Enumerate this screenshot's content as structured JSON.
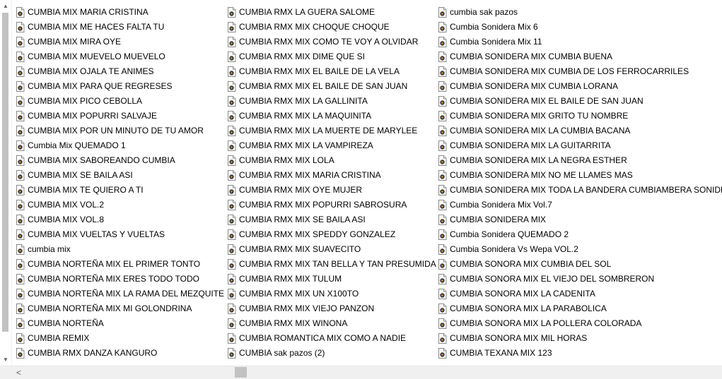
{
  "file_icon": "media-file-icon",
  "scrollbar": {
    "left_arrow": "<",
    "up_arrow": "▲",
    "down_arrow": "▼"
  },
  "columns": [
    [
      "CUMBIA MIX MARIA CRISTINA",
      "CUMBIA MIX ME HACES FALTA TU",
      "CUMBIA MIX MIRA OYE",
      "CUMBIA MIX MUEVELO MUEVELO",
      "CUMBIA MIX OJALA TE ANIMES",
      "CUMBIA MIX PARA QUE REGRESES",
      "CUMBIA MIX PICO CEBOLLA",
      "CUMBIA MIX POPURRI SALVAJE",
      "CUMBIA MIX POR UN MINUTO DE TU AMOR",
      "Cumbia Mix QUEMADO 1",
      "CUMBIA MIX SABOREANDO CUMBIA",
      "CUMBIA MIX SE BAILA ASI",
      "CUMBIA MIX TE QUIERO A TI",
      "CUMBIA MIX VOL.2",
      "CUMBIA MIX VOL.8",
      "CUMBIA MIX VUELTAS Y VUELTAS",
      "cumbia mix",
      "CUMBIA NORTEÑA MIX EL PRIMER TONTO",
      "CUMBIA NORTEÑA MIX ERES TODO TODO",
      "CUMBIA NORTEÑA MIX LA RAMA DEL MEZQUITE",
      "CUMBIA NORTEÑA MIX MI GOLONDRINA",
      "CUMBIA NORTEÑA",
      "CUMBIA REMIX",
      "CUMBIA RMX DANZA KANGURO"
    ],
    [
      "CUMBIA RMX LA GUERA SALOME",
      "CUMBIA RMX MIX CHOQUE CHOQUE",
      "CUMBIA RMX MIX COMO TE VOY A OLVIDAR",
      "CUMBIA RMX MIX DIME QUE SI",
      "CUMBIA RMX MIX EL BAILE DE LA VELA",
      "CUMBIA RMX MIX EL BAILE DE SAN JUAN",
      "CUMBIA RMX MIX LA GALLINITA",
      "CUMBIA RMX MIX LA MAQUINITA",
      "CUMBIA RMX MIX LA MUERTE DE MARYLEE",
      "CUMBIA RMX MIX LA VAMPIREZA",
      "CUMBIA RMX MIX LOLA",
      "CUMBIA RMX MIX MARIA CRISTINA",
      "CUMBIA RMX MIX OYE MUJER",
      "CUMBIA RMX MIX POPURRI SABROSURA",
      "CUMBIA RMX MIX SE BAILA ASI",
      "CUMBIA RMX MIX SPEDDY GONZALEZ",
      "CUMBIA RMX MIX SUAVECITO",
      "CUMBIA RMX MIX TAN BELLA Y TAN PRESUMIDA",
      "CUMBIA RMX MIX TULUM",
      "CUMBIA RMX MIX UN X100TO",
      "CUMBIA RMX MIX VIEJO PANZON",
      "CUMBIA RMX MIX WINONA",
      "CUMBIA ROMANTICA MIX COMO A NADIE",
      "CUMBIA sak pazos (2)"
    ],
    [
      "cumbia sak pazos",
      "Cumbia Sonidera Mix 6",
      "Cumbia Sonidera Mix 11",
      "CUMBIA SONIDERA MIX CUMBIA BUENA",
      "CUMBIA SONIDERA MIX CUMBIA DE LOS FERROCARRILES",
      "CUMBIA SONIDERA MIX CUMBIA LORANA",
      "CUMBIA SONIDERA MIX EL BAILE DE SAN JUAN",
      "CUMBIA SONIDERA MIX GRITO TU NOMBRE",
      "CUMBIA SONIDERA MIX LA CUMBIA BACANA",
      "CUMBIA SONIDERA MIX LA GUITARRITA",
      "CUMBIA SONIDERA MIX LA NEGRA ESTHER",
      "CUMBIA SONIDERA MIX NO ME LLAMES MAS",
      "CUMBIA SONIDERA MIX TODA LA BANDERA CUMBIAMBERA SONIDERA",
      "Cumbia Sonidera Mix Vol.7",
      "CUMBIA SONIDERA MIX",
      "Cumbia Sonidera QUEMADO 2",
      "Cumbia Sonidera Vs Wepa VOL.2",
      "CUMBIA SONORA MIX CUMBIA DEL SOL",
      "CUMBIA SONORA MIX EL VIEJO DEL SOMBRERON",
      "CUMBIA SONORA MIX LA CADENITA",
      "CUMBIA SONORA MIX LA PARABOLICA",
      "CUMBIA SONORA MIX LA POLLERA COLORADA",
      "CUMBIA SONORA MIX MIL HORAS",
      "CUMBIA TEXANA MIX 123"
    ]
  ]
}
